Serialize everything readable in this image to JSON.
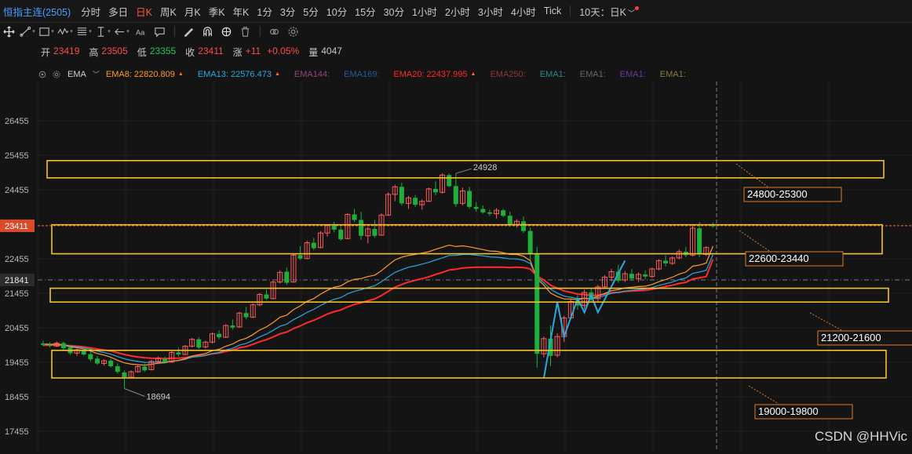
{
  "topbar": {
    "symbol": "恒指主连(2505)",
    "timeframes": [
      {
        "label": "分时",
        "active": false
      },
      {
        "label": "多日",
        "active": false
      },
      {
        "label": "日K",
        "active": true
      },
      {
        "label": "周K",
        "active": false
      },
      {
        "label": "月K",
        "active": false
      },
      {
        "label": "季K",
        "active": false
      },
      {
        "label": "年K",
        "active": false
      },
      {
        "label": "1分",
        "active": false
      },
      {
        "label": "3分",
        "active": false
      },
      {
        "label": "5分",
        "active": false
      },
      {
        "label": "10分",
        "active": false
      },
      {
        "label": "15分",
        "active": false
      },
      {
        "label": "30分",
        "active": false
      },
      {
        "label": "1小时",
        "active": false
      },
      {
        "label": "2小时",
        "active": false
      },
      {
        "label": "3小时",
        "active": false
      },
      {
        "label": "4小时",
        "active": false
      },
      {
        "label": "Tick",
        "active": false
      }
    ],
    "range_select": "10天：日K"
  },
  "toolbar": {
    "tools": [
      "crosshair-icon",
      "trendline-icon",
      "rectangle-icon",
      "wave-icon",
      "fibonacci-icon",
      "vertical-measure-icon",
      "arrow-icon",
      "text-icon",
      "comment-icon",
      "pencil-icon",
      "magnet-icon",
      "link-icon",
      "delete-icon",
      "eye-icon",
      "settings-icon"
    ]
  },
  "ohlc": {
    "open_label": "开",
    "open": "23419",
    "high_label": "高",
    "high": "23505",
    "low_label": "低",
    "low": "23355",
    "close_label": "收",
    "close": "23411",
    "change_label": "涨",
    "change": "+11",
    "change_pct": "+0.05%",
    "volume_label": "量",
    "volume": "4047"
  },
  "ema_legend": {
    "title": "EMA",
    "items": [
      {
        "label": "EMA8:",
        "value": "22820.809",
        "color": "#ff9a2e",
        "arrow": true
      },
      {
        "label": "EMA13:",
        "value": "22576.473",
        "color": "#2aa8e0",
        "arrow": true
      },
      {
        "label": "EMA144:",
        "value": "",
        "color": "#8a4a7a",
        "arrow": false
      },
      {
        "label": "EMA169:",
        "value": "",
        "color": "#2a5a9a",
        "arrow": false
      },
      {
        "label": "EMA20:",
        "value": "22437.995",
        "color": "#ff2a2a",
        "arrow": true
      },
      {
        "label": "EMA250:",
        "value": "",
        "color": "#8a3a3a",
        "arrow": false
      },
      {
        "label": "EMA1:",
        "value": "",
        "color": "#2a8a8a",
        "arrow": false
      },
      {
        "label": "EMA1:",
        "value": "",
        "color": "#666666",
        "arrow": false
      },
      {
        "label": "EMA1:",
        "value": "",
        "color": "#6a3a9a",
        "arrow": false
      },
      {
        "label": "EMA1:",
        "value": "",
        "color": "#8a7a3a",
        "arrow": false
      }
    ]
  },
  "chart_data": {
    "type": "candlestick",
    "y_ticks": [
      "26455",
      "25455",
      "24455",
      "23411",
      "22455",
      "21841",
      "21455",
      "20455",
      "19455",
      "18455",
      "17455"
    ],
    "ylim": [
      17300,
      26900
    ],
    "current_price": "23411",
    "crosshair_price": "21841",
    "high_annotation": "24928",
    "low_annotation": "18694",
    "zones": [
      {
        "label": "24800-25300",
        "low": 24800,
        "high": 25300
      },
      {
        "label": "22600-23440",
        "low": 22600,
        "high": 23440
      },
      {
        "label": "21200-21600",
        "low": 21200,
        "high": 21600
      },
      {
        "label": "19000-19800",
        "low": 19000,
        "high": 19800
      }
    ],
    "colors": {
      "up": "#ff5a5a",
      "down": "#1fae3a",
      "zone": "#f2c12e",
      "ema8": "#ff9a2e",
      "ema13": "#2aa8e0",
      "ema20": "#ff2a2a",
      "wave": "#2aa8e0"
    },
    "candles": [
      [
        20000,
        20080,
        19920,
        19960
      ],
      [
        19960,
        20040,
        19880,
        19930
      ],
      [
        19920,
        20060,
        19900,
        20010
      ],
      [
        20010,
        20050,
        19820,
        19860
      ],
      [
        19880,
        19960,
        19680,
        19720
      ],
      [
        19720,
        19860,
        19640,
        19820
      ],
      [
        19820,
        19880,
        19650,
        19680
      ],
      [
        19690,
        19760,
        19480,
        19540
      ],
      [
        19560,
        19640,
        19380,
        19420
      ],
      [
        19420,
        19540,
        19360,
        19500
      ],
      [
        19500,
        19560,
        19300,
        19340
      ],
      [
        19340,
        19420,
        19120,
        19180
      ],
      [
        19160,
        19220,
        18694,
        19020
      ],
      [
        19020,
        19220,
        19000,
        19180
      ],
      [
        19180,
        19380,
        19150,
        19330
      ],
      [
        19330,
        19420,
        19180,
        19220
      ],
      [
        19240,
        19520,
        19220,
        19480
      ],
      [
        19480,
        19620,
        19400,
        19560
      ],
      [
        19560,
        19620,
        19420,
        19460
      ],
      [
        19460,
        19780,
        19440,
        19740
      ],
      [
        19740,
        19880,
        19620,
        19680
      ],
      [
        19680,
        19960,
        19660,
        19920
      ],
      [
        19920,
        20160,
        19880,
        20120
      ],
      [
        20120,
        20180,
        19840,
        19880
      ],
      [
        19900,
        20080,
        19850,
        20040
      ],
      [
        20040,
        20320,
        20000,
        20280
      ],
      [
        20280,
        20380,
        20120,
        20180
      ],
      [
        20180,
        20560,
        20160,
        20520
      ],
      [
        20520,
        20700,
        20400,
        20460
      ],
      [
        20480,
        20920,
        20450,
        20880
      ],
      [
        20880,
        21060,
        20700,
        20760
      ],
      [
        20760,
        21160,
        20740,
        21120
      ],
      [
        21120,
        21460,
        21080,
        21420
      ],
      [
        21420,
        21560,
        21260,
        21300
      ],
      [
        21300,
        21820,
        21280,
        21780
      ],
      [
        21780,
        22120,
        21740,
        22060
      ],
      [
        22080,
        22200,
        21700,
        21760
      ],
      [
        21780,
        22600,
        21760,
        22560
      ],
      [
        22560,
        22820,
        22420,
        22460
      ],
      [
        22460,
        22980,
        22440,
        22920
      ],
      [
        22920,
        23060,
        22700,
        22760
      ],
      [
        22780,
        23260,
        22760,
        23200
      ],
      [
        23200,
        23460,
        23100,
        23420
      ],
      [
        23420,
        23520,
        23220,
        23300
      ],
      [
        23300,
        23380,
        22980,
        23020
      ],
      [
        23040,
        23780,
        23020,
        23740
      ],
      [
        23740,
        23900,
        23520,
        23580
      ],
      [
        23580,
        23820,
        23000,
        23120
      ],
      [
        23120,
        23380,
        22900,
        23320
      ],
      [
        23320,
        23580,
        23060,
        23120
      ],
      [
        23140,
        23780,
        23120,
        23720
      ],
      [
        23720,
        24380,
        23700,
        24320
      ],
      [
        24320,
        24600,
        24120,
        24540
      ],
      [
        24540,
        24660,
        24000,
        24060
      ],
      [
        24060,
        24280,
        23900,
        24220
      ],
      [
        24220,
        24300,
        23960,
        24020
      ],
      [
        24020,
        24180,
        23880,
        24120
      ],
      [
        24120,
        24520,
        24100,
        24480
      ],
      [
        24480,
        24700,
        24300,
        24380
      ],
      [
        24380,
        24928,
        24340,
        24880
      ],
      [
        24880,
        24928,
        24520,
        24560
      ],
      [
        24560,
        24928,
        23960,
        24040
      ],
      [
        24060,
        24520,
        24000,
        24420
      ],
      [
        24420,
        24540,
        23900,
        23960
      ],
      [
        23960,
        24100,
        23820,
        23900
      ],
      [
        23900,
        24000,
        23760,
        23800
      ],
      [
        23800,
        23880,
        23700,
        23760
      ],
      [
        23760,
        23920,
        23620,
        23860
      ],
      [
        23860,
        23900,
        23660,
        23700
      ],
      [
        23700,
        23820,
        23380,
        23440
      ],
      [
        23440,
        23600,
        23360,
        23540
      ],
      [
        23540,
        23680,
        23200,
        23260
      ],
      [
        23260,
        23360,
        22400,
        22600
      ],
      [
        22600,
        22800,
        19300,
        19700
      ],
      [
        19700,
        20200,
        19600,
        20140
      ],
      [
        20140,
        20520,
        19340,
        19640
      ],
      [
        19660,
        20300,
        19600,
        20200
      ],
      [
        20200,
        20800,
        20040,
        20740
      ],
      [
        20740,
        21280,
        20700,
        21220
      ],
      [
        21220,
        21400,
        20980,
        21100
      ],
      [
        21100,
        21560,
        21000,
        21480
      ],
      [
        21480,
        21600,
        21220,
        21300
      ],
      [
        21300,
        21700,
        21200,
        21640
      ],
      [
        21640,
        21980,
        21600,
        21920
      ],
      [
        21920,
        22160,
        21800,
        22080
      ],
      [
        22080,
        22280,
        21760,
        21820
      ],
      [
        21840,
        22100,
        21780,
        22020
      ],
      [
        22020,
        22160,
        21820,
        21880
      ],
      [
        21880,
        22060,
        21780,
        22000
      ],
      [
        22000,
        22120,
        21860,
        21940
      ],
      [
        21940,
        22200,
        21900,
        22160
      ],
      [
        22160,
        22440,
        22120,
        22400
      ],
      [
        22400,
        22560,
        22240,
        22320
      ],
      [
        22320,
        22520,
        22280,
        22480
      ],
      [
        22480,
        22720,
        22440,
        22660
      ],
      [
        22660,
        22800,
        22500,
        22560
      ],
      [
        22560,
        23460,
        22520,
        23340
      ],
      [
        23340,
        23520,
        22500,
        22580
      ],
      [
        22580,
        22820,
        22540,
        22780
      ],
      [
        23419,
        23505,
        23355,
        23411
      ]
    ],
    "ema8": [
      19990,
      19975,
      19980,
      19955,
      19900,
      19880,
      19840,
      19780,
      19710,
      19665,
      19600,
      19510,
      19440,
      19400,
      19385,
      19370,
      19395,
      19430,
      19440,
      19485,
      19510,
      19560,
      19640,
      19670,
      19710,
      19790,
      19830,
      19920,
      19985,
      20090,
      20150,
      20255,
      20390,
      20480,
      20610,
      20760,
      20820,
      20980,
      21090,
      21220,
      21300,
      21430,
      21540,
      21630,
      21670,
      21790,
      21860,
      21880,
      21940,
      21980,
      22110,
      22270,
      22420,
      22500,
      22550,
      22580,
      22620,
      22660,
      22730,
      22790,
      22850,
      22810,
      22830,
      22800,
      22760,
      22720,
      22680,
      22670,
      22630,
      22580,
      22580,
      22530,
      22400,
      21870,
      21690,
      21460,
      21360,
      21290,
      21290,
      21270,
      21310,
      21300,
      21370,
      21450,
      21530,
      21560,
      21610,
      21630,
      21650,
      21660,
      21710,
      21790,
      21850,
      21920,
      22010,
      22070,
      22240,
      22270,
      22330,
      22820
    ],
    "ema13": [
      19980,
      19970,
      19972,
      19960,
      19925,
      19905,
      19875,
      19830,
      19780,
      19740,
      19690,
      19620,
      19560,
      19510,
      19480,
      19450,
      19450,
      19460,
      19460,
      19490,
      19505,
      19540,
      19600,
      19620,
      19650,
      19710,
      19740,
      19810,
      19860,
      19950,
      20000,
      20090,
      20190,
      20270,
      20380,
      20500,
      20560,
      20690,
      20790,
      20900,
      20990,
      21100,
      21200,
      21280,
      21330,
      21440,
      21510,
      21560,
      21620,
      21670,
      21790,
      21930,
      22060,
      22140,
      22210,
      22250,
      22300,
      22350,
      22420,
      22480,
      22550,
      22550,
      22580,
      22580,
      22560,
      22540,
      22510,
      22500,
      22480,
      22450,
      22450,
      22410,
      22320,
      21920,
      21760,
      21570,
      21460,
      21370,
      21340,
      21300,
      21310,
      21290,
      21330,
      21390,
      21450,
      21480,
      21520,
      21540,
      21560,
      21580,
      21620,
      21680,
      21730,
      21780,
      21850,
      21900,
      22030,
      22070,
      22120,
      22576
    ],
    "ema20": [
      19950,
      19950,
      19955,
      19950,
      19935,
      19920,
      19900,
      19870,
      19840,
      19810,
      19780,
      19730,
      19680,
      19640,
      19610,
      19585,
      19575,
      19570,
      19560,
      19570,
      19575,
      19590,
      19625,
      19640,
      19660,
      19700,
      19720,
      19770,
      19810,
      19875,
      19910,
      19975,
      20050,
      20110,
      20190,
      20280,
      20330,
      20430,
      20510,
      20600,
      20670,
      20760,
      20850,
      20920,
      20970,
      21060,
      21130,
      21180,
      21240,
      21290,
      21390,
      21510,
      21630,
      21710,
      21780,
      21830,
      21880,
      21930,
      22000,
      22060,
      22130,
      22150,
      22190,
      22200,
      22210,
      22210,
      22210,
      22210,
      22210,
      22200,
      22210,
      22200,
      22160,
      21950,
      21840,
      21690,
      21600,
      21520,
      21480,
      21430,
      21420,
      21390,
      21400,
      21430,
      21470,
      21480,
      21510,
      21520,
      21530,
      21540,
      21570,
      21610,
      21650,
      21690,
      21740,
      21770,
      21870,
      21900,
      21940,
      22438
    ],
    "wave_points": [
      [
        74,
        19000
      ],
      [
        76,
        21200
      ],
      [
        77,
        20200
      ],
      [
        79,
        21300
      ],
      [
        80,
        20900
      ],
      [
        81,
        21400
      ],
      [
        82,
        20900
      ],
      [
        86,
        22400
      ]
    ]
  },
  "watermark": "CSDN @HHVic"
}
